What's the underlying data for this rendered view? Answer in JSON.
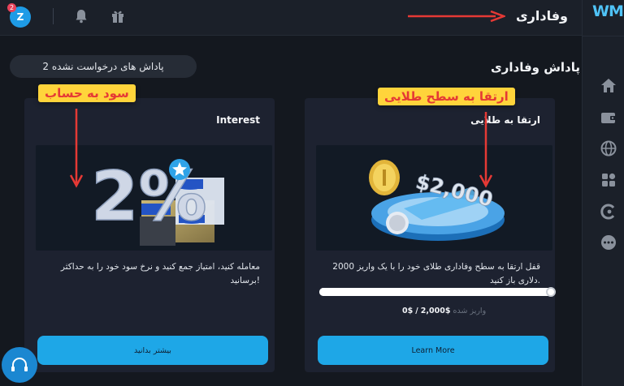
{
  "topbar": {
    "avatar_letter": "Z",
    "avatar_badge": "2",
    "page_title": "وفاداری"
  },
  "section": {
    "title": "پاداش وفاداری",
    "pill_text": "2 پاداش های درخواست نشده"
  },
  "cards": {
    "interest": {
      "title": "Interest",
      "description": "معامله کنید، امتیاز جمع کنید و نرخ سود خود را به حداکثر برسانید!",
      "button_label": "بیشتر بدانید"
    },
    "gold": {
      "title": "ارتقا به طلایی",
      "description": "قفل ارتقا به سطح وفاداری طلای خود را با یک واریز 2000 دلاری باز کنید.",
      "button_label": "Learn More",
      "progress_fraction": 1.0,
      "progress_current": "$0",
      "progress_separator": "/",
      "progress_target": "$2,000",
      "progress_caption": "واریز شده"
    }
  },
  "annotations": {
    "left_label": "سود به حساب",
    "right_label": "ارتقا به سطح طلایی"
  },
  "images": {
    "interest_big_text": "2%",
    "gold_amount_text": "$2,000"
  },
  "icons": {
    "sidebar": [
      "home-icon",
      "wallet-icon",
      "globe-icon",
      "apps-icon",
      "cashback-icon",
      "more-icon"
    ],
    "top": [
      "bell-icon",
      "gift-icon"
    ]
  },
  "colors": {
    "accent": "#1ea7e7",
    "annotation_bg": "#ffd43b",
    "annotation_text": "#e53935",
    "arrow": "#e53935"
  },
  "logo_text": "WM"
}
